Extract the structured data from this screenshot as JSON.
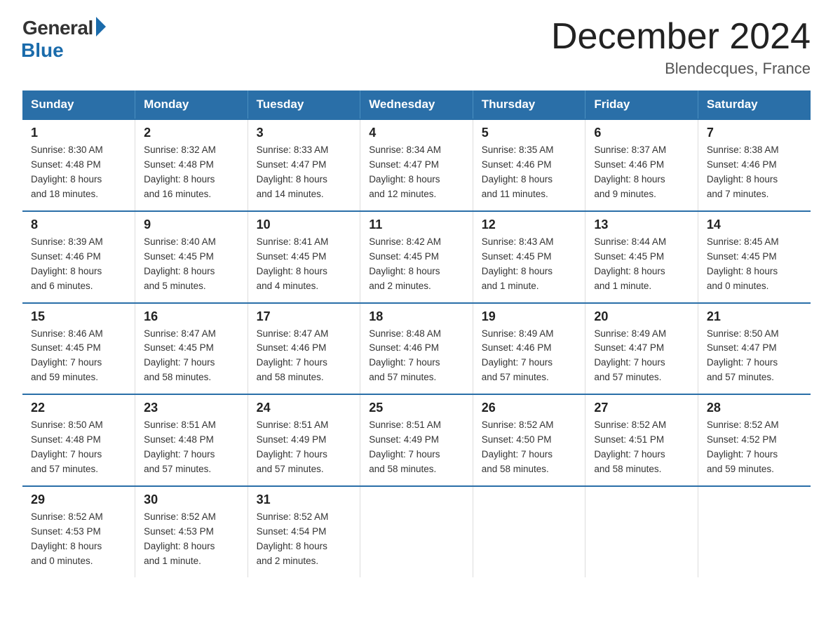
{
  "header": {
    "logo_general": "General",
    "logo_blue": "Blue",
    "title": "December 2024",
    "subtitle": "Blendecques, France"
  },
  "columns": [
    "Sunday",
    "Monday",
    "Tuesday",
    "Wednesday",
    "Thursday",
    "Friday",
    "Saturday"
  ],
  "weeks": [
    [
      {
        "day": "1",
        "info": "Sunrise: 8:30 AM\nSunset: 4:48 PM\nDaylight: 8 hours\nand 18 minutes."
      },
      {
        "day": "2",
        "info": "Sunrise: 8:32 AM\nSunset: 4:48 PM\nDaylight: 8 hours\nand 16 minutes."
      },
      {
        "day": "3",
        "info": "Sunrise: 8:33 AM\nSunset: 4:47 PM\nDaylight: 8 hours\nand 14 minutes."
      },
      {
        "day": "4",
        "info": "Sunrise: 8:34 AM\nSunset: 4:47 PM\nDaylight: 8 hours\nand 12 minutes."
      },
      {
        "day": "5",
        "info": "Sunrise: 8:35 AM\nSunset: 4:46 PM\nDaylight: 8 hours\nand 11 minutes."
      },
      {
        "day": "6",
        "info": "Sunrise: 8:37 AM\nSunset: 4:46 PM\nDaylight: 8 hours\nand 9 minutes."
      },
      {
        "day": "7",
        "info": "Sunrise: 8:38 AM\nSunset: 4:46 PM\nDaylight: 8 hours\nand 7 minutes."
      }
    ],
    [
      {
        "day": "8",
        "info": "Sunrise: 8:39 AM\nSunset: 4:46 PM\nDaylight: 8 hours\nand 6 minutes."
      },
      {
        "day": "9",
        "info": "Sunrise: 8:40 AM\nSunset: 4:45 PM\nDaylight: 8 hours\nand 5 minutes."
      },
      {
        "day": "10",
        "info": "Sunrise: 8:41 AM\nSunset: 4:45 PM\nDaylight: 8 hours\nand 4 minutes."
      },
      {
        "day": "11",
        "info": "Sunrise: 8:42 AM\nSunset: 4:45 PM\nDaylight: 8 hours\nand 2 minutes."
      },
      {
        "day": "12",
        "info": "Sunrise: 8:43 AM\nSunset: 4:45 PM\nDaylight: 8 hours\nand 1 minute."
      },
      {
        "day": "13",
        "info": "Sunrise: 8:44 AM\nSunset: 4:45 PM\nDaylight: 8 hours\nand 1 minute."
      },
      {
        "day": "14",
        "info": "Sunrise: 8:45 AM\nSunset: 4:45 PM\nDaylight: 8 hours\nand 0 minutes."
      }
    ],
    [
      {
        "day": "15",
        "info": "Sunrise: 8:46 AM\nSunset: 4:45 PM\nDaylight: 7 hours\nand 59 minutes."
      },
      {
        "day": "16",
        "info": "Sunrise: 8:47 AM\nSunset: 4:45 PM\nDaylight: 7 hours\nand 58 minutes."
      },
      {
        "day": "17",
        "info": "Sunrise: 8:47 AM\nSunset: 4:46 PM\nDaylight: 7 hours\nand 58 minutes."
      },
      {
        "day": "18",
        "info": "Sunrise: 8:48 AM\nSunset: 4:46 PM\nDaylight: 7 hours\nand 57 minutes."
      },
      {
        "day": "19",
        "info": "Sunrise: 8:49 AM\nSunset: 4:46 PM\nDaylight: 7 hours\nand 57 minutes."
      },
      {
        "day": "20",
        "info": "Sunrise: 8:49 AM\nSunset: 4:47 PM\nDaylight: 7 hours\nand 57 minutes."
      },
      {
        "day": "21",
        "info": "Sunrise: 8:50 AM\nSunset: 4:47 PM\nDaylight: 7 hours\nand 57 minutes."
      }
    ],
    [
      {
        "day": "22",
        "info": "Sunrise: 8:50 AM\nSunset: 4:48 PM\nDaylight: 7 hours\nand 57 minutes."
      },
      {
        "day": "23",
        "info": "Sunrise: 8:51 AM\nSunset: 4:48 PM\nDaylight: 7 hours\nand 57 minutes."
      },
      {
        "day": "24",
        "info": "Sunrise: 8:51 AM\nSunset: 4:49 PM\nDaylight: 7 hours\nand 57 minutes."
      },
      {
        "day": "25",
        "info": "Sunrise: 8:51 AM\nSunset: 4:49 PM\nDaylight: 7 hours\nand 58 minutes."
      },
      {
        "day": "26",
        "info": "Sunrise: 8:52 AM\nSunset: 4:50 PM\nDaylight: 7 hours\nand 58 minutes."
      },
      {
        "day": "27",
        "info": "Sunrise: 8:52 AM\nSunset: 4:51 PM\nDaylight: 7 hours\nand 58 minutes."
      },
      {
        "day": "28",
        "info": "Sunrise: 8:52 AM\nSunset: 4:52 PM\nDaylight: 7 hours\nand 59 minutes."
      }
    ],
    [
      {
        "day": "29",
        "info": "Sunrise: 8:52 AM\nSunset: 4:53 PM\nDaylight: 8 hours\nand 0 minutes."
      },
      {
        "day": "30",
        "info": "Sunrise: 8:52 AM\nSunset: 4:53 PM\nDaylight: 8 hours\nand 1 minute."
      },
      {
        "day": "31",
        "info": "Sunrise: 8:52 AM\nSunset: 4:54 PM\nDaylight: 8 hours\nand 2 minutes."
      },
      {
        "day": "",
        "info": ""
      },
      {
        "day": "",
        "info": ""
      },
      {
        "day": "",
        "info": ""
      },
      {
        "day": "",
        "info": ""
      }
    ]
  ]
}
